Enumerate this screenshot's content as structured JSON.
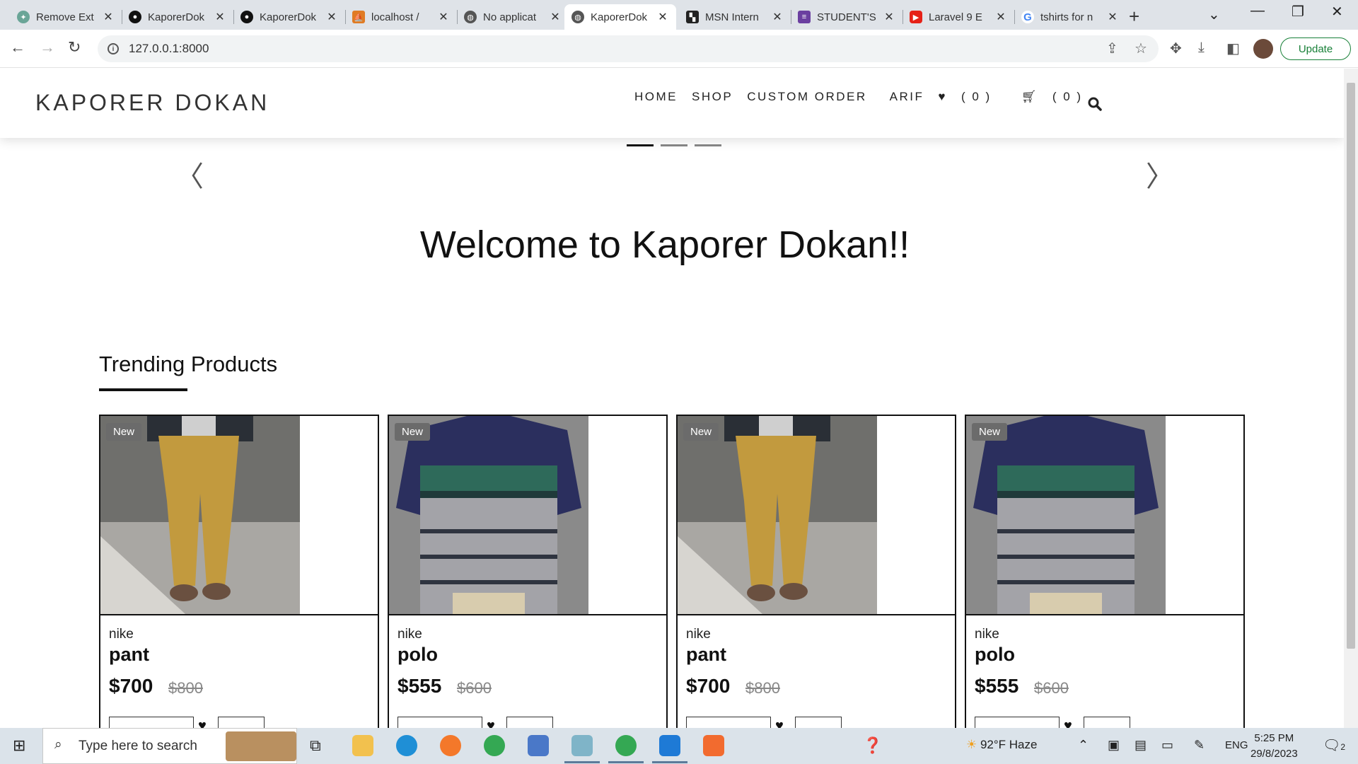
{
  "browser": {
    "tabs": [
      {
        "title": "Remove Ext",
        "icon": "chatgpt-icon",
        "color": "#6aa597"
      },
      {
        "title": "KaporerDok",
        "icon": "github-icon",
        "color": "#111111"
      },
      {
        "title": "KaporerDok",
        "icon": "github-icon",
        "color": "#111111"
      },
      {
        "title": "localhost /",
        "icon": "phpmyadmin-icon",
        "color": "#e07b24"
      },
      {
        "title": "No applicat",
        "icon": "globe-icon",
        "color": "#555555"
      },
      {
        "title": "KaporerDok",
        "icon": "globe-icon",
        "color": "#555555"
      },
      {
        "title": "MSN Intern",
        "icon": "msn-icon",
        "color": "#222222"
      },
      {
        "title": "STUDENT'S",
        "icon": "forms-icon",
        "color": "#6b3fa0"
      },
      {
        "title": "Laravel 9 E",
        "icon": "youtube-icon",
        "color": "#e62117"
      },
      {
        "title": "tshirts for n",
        "icon": "google-icon",
        "color": "#4285f4"
      }
    ],
    "active_tab_index": 5,
    "url": "127.0.0.1:8000",
    "update_label": "Update"
  },
  "site": {
    "brand": "KAPORER DOKAN",
    "menu": [
      "HOME",
      "SHOP",
      "CUSTOM ORDER",
      "ARIF"
    ],
    "wishlist_count": "( 0 )",
    "cart_count": "( 0 )",
    "welcome": "Welcome to Kaporer Dokan!!",
    "slider_active_index": 0,
    "slider_count": 3,
    "trending_title": "Trending Products"
  },
  "products": [
    {
      "badge": "New",
      "brand": "nike",
      "name": "pant",
      "price": "$700",
      "old_price": "$800",
      "image": "pant"
    },
    {
      "badge": "New",
      "brand": "nike",
      "name": "polo",
      "price": "$555",
      "old_price": "$600",
      "image": "polo"
    },
    {
      "badge": "New",
      "brand": "nike",
      "name": "pant",
      "price": "$700",
      "old_price": "$800",
      "image": "pant"
    },
    {
      "badge": "New",
      "brand": "nike",
      "name": "polo",
      "price": "$555",
      "old_price": "$600",
      "image": "polo"
    }
  ],
  "taskbar": {
    "search_placeholder": "Type here to search",
    "weather": "92°F  Haze",
    "language": "ENG",
    "time": "5:25 PM",
    "date": "29/8/2023",
    "notifications": "2"
  }
}
